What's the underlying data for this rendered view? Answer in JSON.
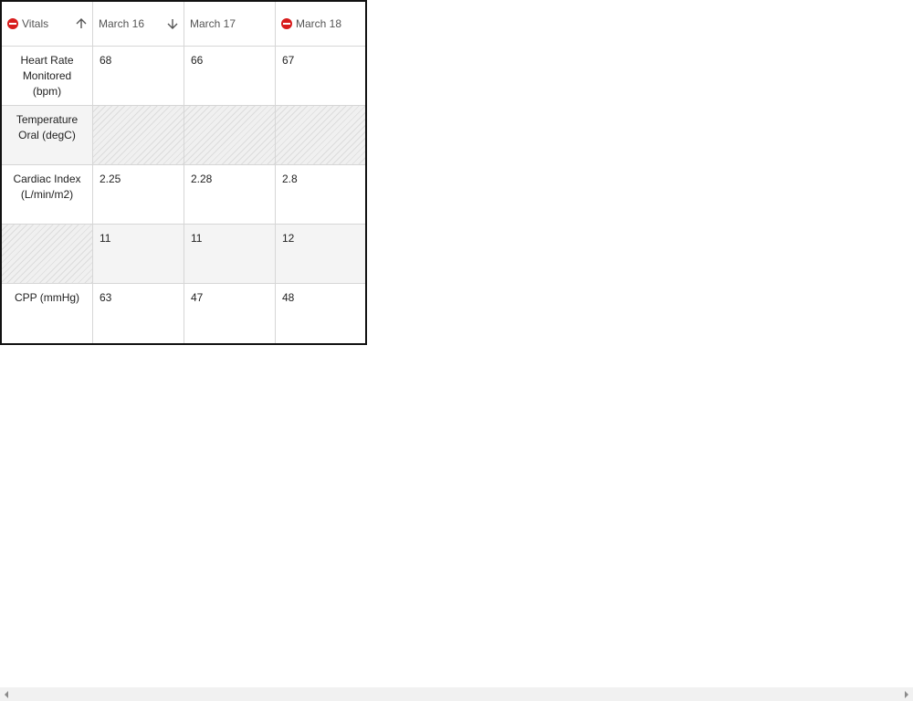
{
  "header": {
    "vitals": "Vitals",
    "col1": "March 16",
    "col2": "March 17",
    "col3": "March 18"
  },
  "icons": {
    "filter_badge": "no-entry-icon",
    "sort_up": "arrow-up-icon",
    "sort_down": "arrow-down-icon",
    "scroll_left": "triangle-left-icon",
    "scroll_right": "triangle-right-icon"
  },
  "colors": {
    "filter_badge": "#d81c1c",
    "grid_border": "#111111",
    "alt_row": "#f4f4f4"
  },
  "rows": [
    {
      "label": "Heart Rate Monitored (bpm)",
      "values": [
        "68",
        "66",
        "67"
      ]
    },
    {
      "label": "Temperature Oral (degC)",
      "values": [
        "",
        "",
        ""
      ]
    },
    {
      "label": "Cardiac Index (L/min/m2)",
      "values": [
        "2.25",
        "2.28",
        "2.8"
      ]
    },
    {
      "label": "",
      "values": [
        "11",
        "11",
        "12"
      ]
    },
    {
      "label": "CPP (mmHg)",
      "values": [
        "63",
        "47",
        "48"
      ]
    }
  ]
}
